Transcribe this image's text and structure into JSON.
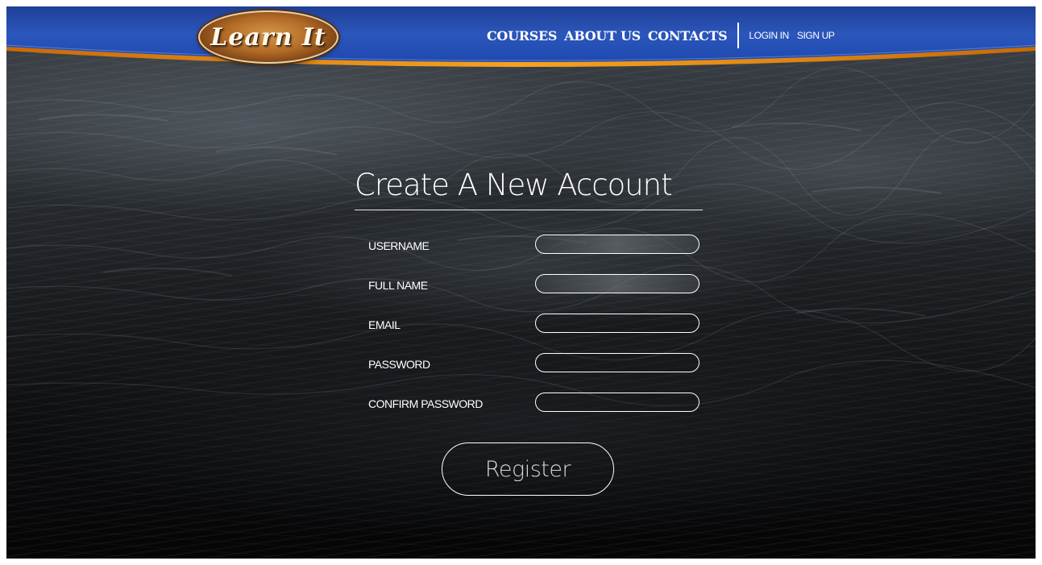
{
  "header": {
    "logo_text": "Learn It",
    "nav_main": [
      "COURSES",
      "ABOUT US",
      "CONTACTS"
    ],
    "nav_auth": [
      "LOGIN IN",
      "SIGN UP"
    ]
  },
  "form": {
    "title": "Create A New Account",
    "fields": [
      {
        "label": "USERNAME",
        "value": ""
      },
      {
        "label": "FULL NAME",
        "value": ""
      },
      {
        "label": "EMAIL",
        "value": ""
      },
      {
        "label": "PASSWORD",
        "value": ""
      },
      {
        "label": "CONFIRM PASSWORD",
        "value": ""
      }
    ],
    "register_label": "Register"
  },
  "colors": {
    "header_blue": "#2a56b8",
    "header_accent": "#f29a1e",
    "logo_wood": "#b26a26",
    "text": "#ffffff"
  },
  "icons": {
    "logo": "wooden-oval-logo"
  }
}
